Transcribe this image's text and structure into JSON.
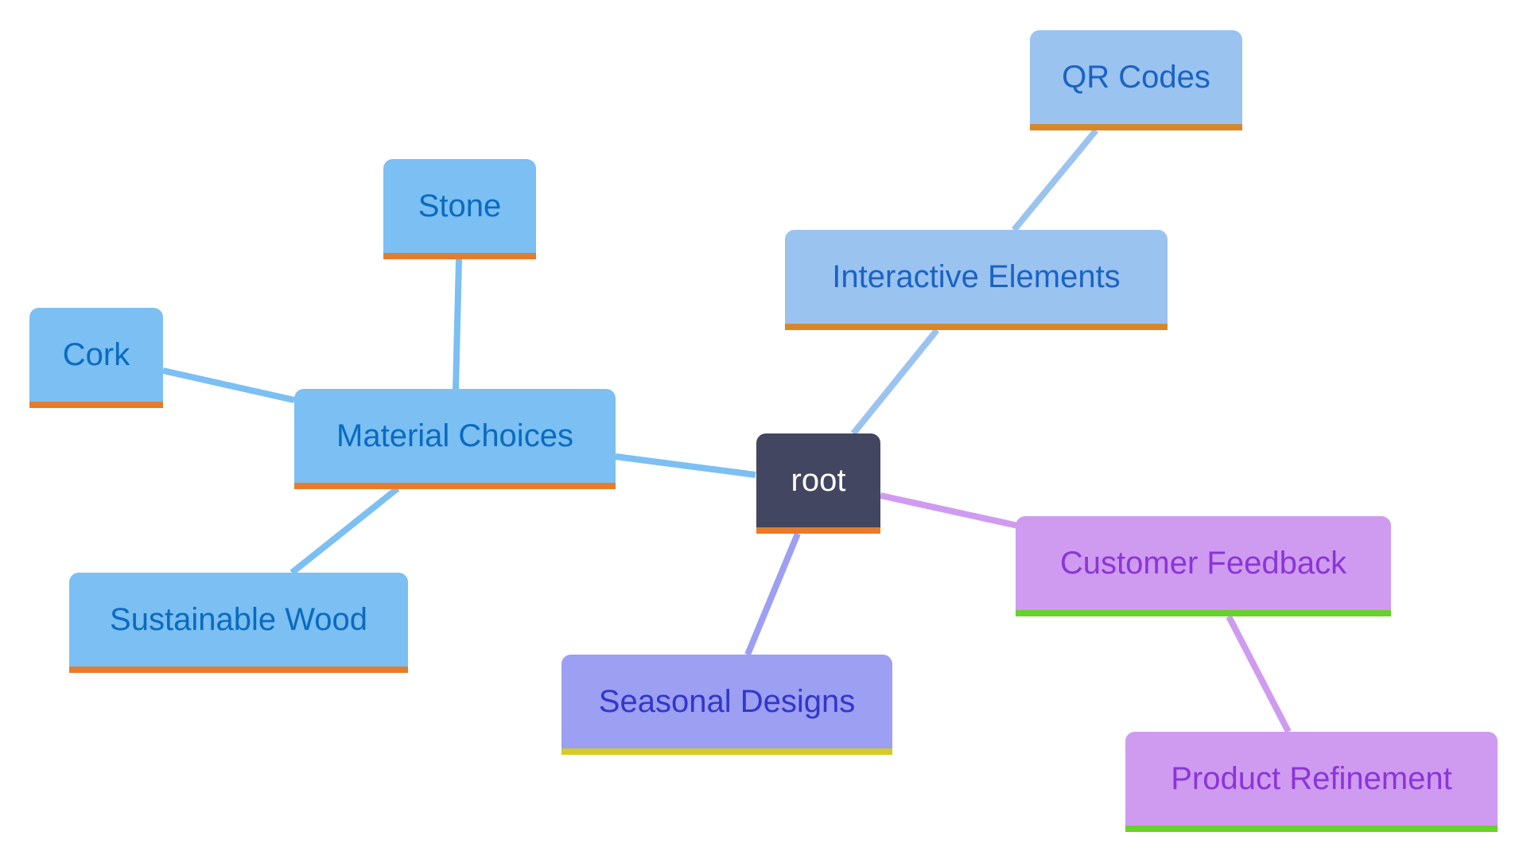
{
  "diagram": {
    "type": "mindmap",
    "nodes": [
      {
        "id": "root",
        "label": "root",
        "fill": "#424660",
        "text": "#ffffff",
        "bar": "#e87b2a",
        "edge": null
      },
      {
        "id": "material",
        "label": "Material Choices",
        "fill": "#7bbff3",
        "text": "#0a6bbf",
        "bar": "#e87b2a",
        "parent": "root",
        "edge": "#7bbff3"
      },
      {
        "id": "stone",
        "label": "Stone",
        "fill": "#7bbff3",
        "text": "#0a6bbf",
        "bar": "#e87b2a",
        "parent": "material",
        "edge": "#7bbff3"
      },
      {
        "id": "cork",
        "label": "Cork",
        "fill": "#7bbff3",
        "text": "#0a6bbf",
        "bar": "#e87b2a",
        "parent": "material",
        "edge": "#7bbff3"
      },
      {
        "id": "wood",
        "label": "Sustainable Wood",
        "fill": "#7bbff3",
        "text": "#0a6bbf",
        "bar": "#e87b2a",
        "parent": "material",
        "edge": "#7bbff3"
      },
      {
        "id": "interactive",
        "label": "Interactive Elements",
        "fill": "#9bc3ef",
        "text": "#1a63c4",
        "bar": "#d6872a",
        "parent": "root",
        "edge": "#9bc3ef"
      },
      {
        "id": "qr",
        "label": "QR Codes",
        "fill": "#9bc3ef",
        "text": "#1a63c4",
        "bar": "#d6872a",
        "parent": "interactive",
        "edge": "#9bc3ef"
      },
      {
        "id": "feedback",
        "label": "Customer Feedback",
        "fill": "#cf9bf1",
        "text": "#8b35d6",
        "bar": "#67d22a",
        "parent": "root",
        "edge": "#cf9bf1"
      },
      {
        "id": "refine",
        "label": "Product Refinement",
        "fill": "#cf9bf1",
        "text": "#8b35d6",
        "bar": "#67d22a",
        "parent": "feedback",
        "edge": "#cf9bf1"
      },
      {
        "id": "seasonal",
        "label": "Seasonal Designs",
        "fill": "#9c9ff2",
        "text": "#3336c9",
        "bar": "#d6cb22",
        "parent": "root",
        "edge": "#9c9ff2"
      }
    ]
  }
}
